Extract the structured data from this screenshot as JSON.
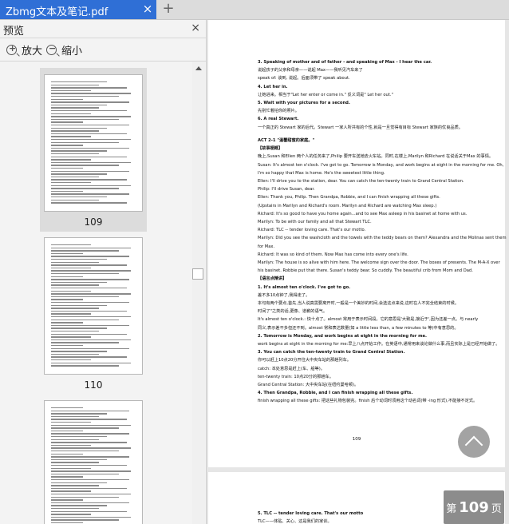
{
  "tab": {
    "title": "Zbmg文本及笔记.pdf",
    "close": "×",
    "new": "+"
  },
  "sidebar": {
    "title": "预览",
    "close": "×",
    "zoom_in": "放大",
    "zoom_out": "缩小",
    "thumbnails": [
      {
        "label": "109"
      },
      {
        "label": "110"
      }
    ]
  },
  "page": {
    "lines": [
      {
        "t": "3. Speaking of mother and of father - and speaking of Max - I hear the car.",
        "b": true
      },
      {
        "t": "说起孩子的父亲和母亲——说起 Max——我听见汽车来了"
      },
      {
        "t": "speak of: 谈到, 说起。后面须带了 speak about."
      },
      {
        "t": "4. Let her in.",
        "b": true
      },
      {
        "t": "让她进来。相当于\"Let her enter or come in.\" 反义词是\" Let her out.\""
      },
      {
        "t": "5. Wait with your pictures for a second.",
        "b": true
      },
      {
        "t": "先别忙着拍你的照片。"
      },
      {
        "t": "6. A real Stewart.",
        "b": true
      },
      {
        "t": "一个真正的 Stewart 家的后代。Stewart 一家人所共有的个性,就是一旦觉得有目标 Stewart 家族的优良品质。"
      },
      {
        "t": ""
      },
      {
        "t": "ACT 2-1 \"温馨甜蜜的家庭。\"",
        "b": true
      },
      {
        "t": "【故事梗概】",
        "b": true
      },
      {
        "t": "晚上,Susan 和Ellen 两个人的任务来了,Philip 要开车送她去火车站。同时,在楼上,Marilyn 和Richard 在说话关于Max 的事情。"
      },
      {
        "t": "Susan: It's almost ten o'clock. I've got to go. Tomorrow is Monday, and work begins at eight in the morning for me. Oh,"
      },
      {
        "t": "I'm so happy that Max is home. He's the sweetest little thing."
      },
      {
        "t": "Ellen: I'll drive you to the station, dear. You can catch the ten-twenty train to Grand Central Station."
      },
      {
        "t": "Philip: I'll drive Susan, dear."
      },
      {
        "t": "Ellen: Thank you, Philip. Then Grandpa, Robbie, and I can finish wrapping all these gifts."
      },
      {
        "t": "(Upstairs in Marilyn and Richard's room. Marilyn and Richard are watching Max sleep.)"
      },
      {
        "t": "Richard: It's so good to have you home again...and to see Max asleep in his basinet at home with us."
      },
      {
        "t": "Marilyn: To be with our family and all that Stewart TLC."
      },
      {
        "t": "Richard: TLC -- tender loving care. That's our motto."
      },
      {
        "t": "Marilyn: Did you see the washcloth and the towels with the teddy bears on them? Alexandra and the Molinas sent them"
      },
      {
        "t": "for Max."
      },
      {
        "t": "Richard: It was so kind of them. Now Max has come into every one's life."
      },
      {
        "t": "Marilyn: The house is so alive with him here. The welcome sign over the door. The boxes of presents. The M-A-X over"
      },
      {
        "t": "his basinet. Robbie put that there. Susan's teddy bear. So cuddly. The beautiful crib from Mom and Dad."
      },
      {
        "t": "【语言点精讲】",
        "b": true
      },
      {
        "t": "1. It's almost ten o'clock. I've got to go.",
        "b": true
      },
      {
        "t": "差不多10点钟了,我得走了。"
      },
      {
        "t": "本句有两个要点,首先,当人说真需要离开时,一般是一个美妙的时间,会选这点来说,这时在人不完全结束的时候。"
      },
      {
        "t": "时间了\"之类的话,更像、道歉的语气。"
      },
      {
        "t": "It's almost ten o'clock.: 快十点了。almost 常用于表示时间段。它的意思是'大致是,接近于',因为还差一点。与 nearly"
      },
      {
        "t": "同义,表示差不多但还不到。almost 常和表达数量(如 a little less than, a few minutes to 等)中有意思的。"
      },
      {
        "t": "2. Tomorrow is Monday, and work begins at eight in the morning for me.",
        "b": true
      },
      {
        "t": "work begins at eight in the morning for me:早上八点开始工作。在英语中,通常用来谈论做什么事,而且实际上是已经开始做了。"
      },
      {
        "t": "3. You can catch the ten-twenty train to Grand Central Station.",
        "b": true
      },
      {
        "t": "你可以赶上10点20分开往大中央车站的那趟列车。"
      },
      {
        "t": "catch: 本处意思是赶上(车、船等)。"
      },
      {
        "t": "ten-twenty train: 10点20分的那趟车。"
      },
      {
        "t": "Grand Central Station: 大中央车站(在纽约曼哈顿)。"
      },
      {
        "t": "4. Then Grandpa, Robbie, and I can finish wrapping all these gifts.",
        "b": true
      },
      {
        "t": "finish wrapping all these gifts: 把这些礼物包装完。finish 后个动词时须用这个动名词(带 -ing 形式),不能接不定式。"
      }
    ],
    "page_number": "109",
    "page2_lines": [
      {
        "t": "5. TLC -- tender loving care. That's our motto",
        "b": true
      },
      {
        "t": "TLC——体贴、关心、这是我们的家训。"
      }
    ]
  },
  "badge": {
    "prefix": "第",
    "number": "109",
    "suffix": "页"
  }
}
